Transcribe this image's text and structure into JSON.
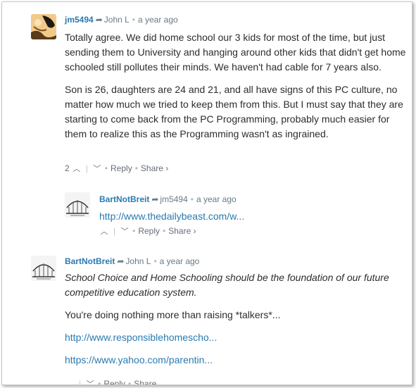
{
  "comments": [
    {
      "author": "jm5494",
      "reply_to": "John L",
      "time": "a year ago",
      "paragraphs": [
        "Totally agree. We did home school our 3 kids for most of the time, but just sending them to University and hanging around other kids that didn't get home schooled still pollutes their minds. We haven't had cable for 7 years also.",
        "Son is 26, daughters are 24 and 21, and all have signs of this PC culture, no matter how much we tried to keep them from this. But I must say that they are starting to come back from the PC Programming, probably much easier for them to realize this as the Programming wasn't as ingrained."
      ],
      "upvotes": "2",
      "reply_label": "Reply",
      "share_label": "Share ›"
    },
    {
      "author": "BartNotBreit",
      "reply_to": "jm5494",
      "time": "a year ago",
      "link": "http://www.thedailybeast.com/w...",
      "reply_label": "Reply",
      "share_label": "Share ›"
    },
    {
      "author": "BartNotBreit",
      "reply_to": "John L",
      "time": "a year ago",
      "italic_text": "School Choice and Home Schooling should be the foundation of our future competitive education system.",
      "text": "You're doing nothing more than raising *talkers*...",
      "link1": "http://www.responsiblehomescho...",
      "link2": "https://www.yahoo.com/parentin...",
      "reply_label": "Reply",
      "share_label": "Share"
    }
  ],
  "icons": {
    "reply_arrow": "reply-arrow-icon",
    "upvote": "chevron-up-icon",
    "downvote": "chevron-down-icon"
  }
}
